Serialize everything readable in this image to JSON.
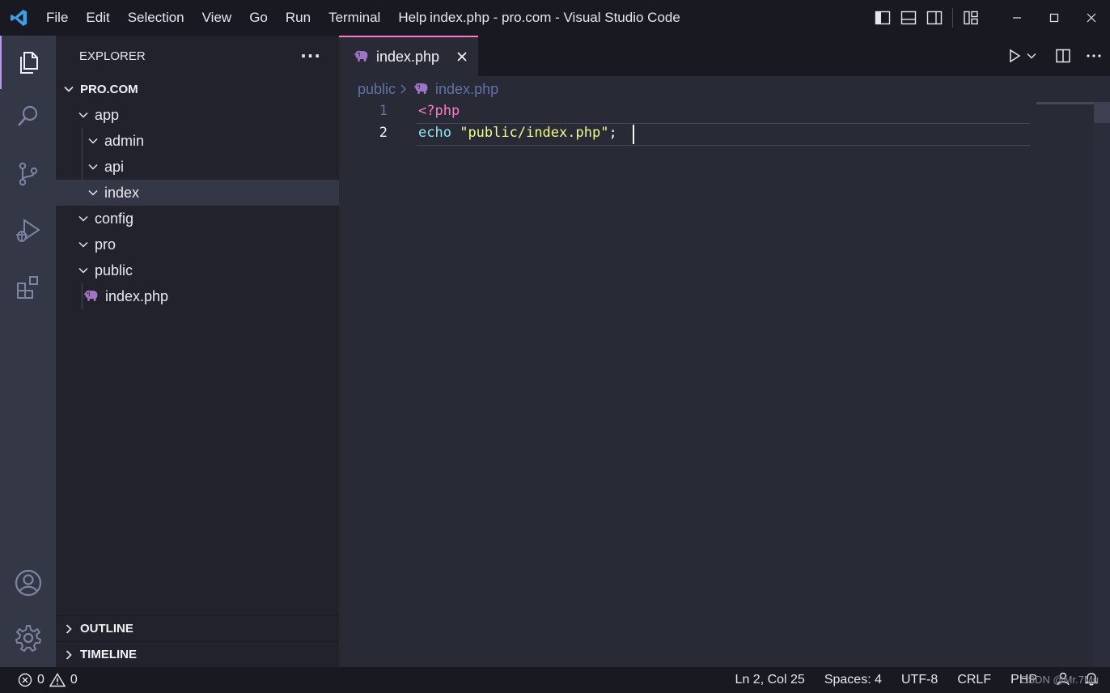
{
  "window": {
    "title": "index.php - pro.com - Visual Studio Code",
    "menu": [
      "File",
      "Edit",
      "Selection",
      "View",
      "Go",
      "Run",
      "Terminal",
      "Help"
    ],
    "controls": [
      "toggle-primary-sidebar-icon",
      "toggle-panel-icon",
      "toggle-secondary-sidebar-icon",
      "customize-layout-icon",
      "minimize-icon",
      "maximize-icon",
      "close-icon"
    ]
  },
  "activity_bar": {
    "items": [
      "explorer-icon",
      "search-icon",
      "source-control-icon",
      "run-debug-icon",
      "extensions-icon"
    ],
    "bottom": [
      "accounts-icon",
      "manage-gear-icon"
    ],
    "active": "explorer-icon"
  },
  "sidebar": {
    "title": "EXPLORER",
    "more_label": "···",
    "root": "PRO.COM",
    "tree": [
      {
        "label": "app",
        "depth": 0,
        "type": "folder",
        "expanded": true
      },
      {
        "label": "admin",
        "depth": 1,
        "type": "folder",
        "expanded": true
      },
      {
        "label": "api",
        "depth": 1,
        "type": "folder",
        "expanded": true
      },
      {
        "label": "index",
        "depth": 1,
        "type": "folder",
        "expanded": true,
        "selected": true
      },
      {
        "label": "config",
        "depth": 0,
        "type": "folder",
        "expanded": true
      },
      {
        "label": "pro",
        "depth": 0,
        "type": "folder",
        "expanded": true
      },
      {
        "label": "public",
        "depth": 0,
        "type": "folder",
        "expanded": true
      },
      {
        "label": "index.php",
        "depth": 1,
        "type": "php-file"
      }
    ],
    "panels": [
      {
        "label": "OUTLINE"
      },
      {
        "label": "TIMELINE"
      }
    ]
  },
  "editor": {
    "tab": {
      "label": "index.php",
      "icon": "php-elephant-icon"
    },
    "breadcrumb": {
      "folder": "public",
      "file": "index.php"
    },
    "lines": [
      {
        "number": "1",
        "tokens": [
          {
            "text": "<?php",
            "color": "#ff79c6"
          }
        ]
      },
      {
        "number": "2",
        "tokens": [
          {
            "text": "echo",
            "color": "#8be9fd"
          },
          {
            "text": " ",
            "color": "#f8f8f2"
          },
          {
            "text": "\"public/index.php\"",
            "color": "#f1fa8c"
          },
          {
            "text": ";",
            "color": "#f8f8f2"
          }
        ]
      }
    ],
    "cursor": {
      "line": 2,
      "col": 25
    }
  },
  "status_bar": {
    "errors": "0",
    "warnings": "0",
    "position": "Ln 2, Col 25",
    "spaces": "Spaces: 4",
    "encoding": "UTF-8",
    "eol": "CRLF",
    "language": "PHP",
    "watermark": "CSDN @Mr.7Mu"
  },
  "colors": {
    "accent": "#bd93f9",
    "tab_top_border": "#ff79c6",
    "php_icon": "#a074c4"
  }
}
